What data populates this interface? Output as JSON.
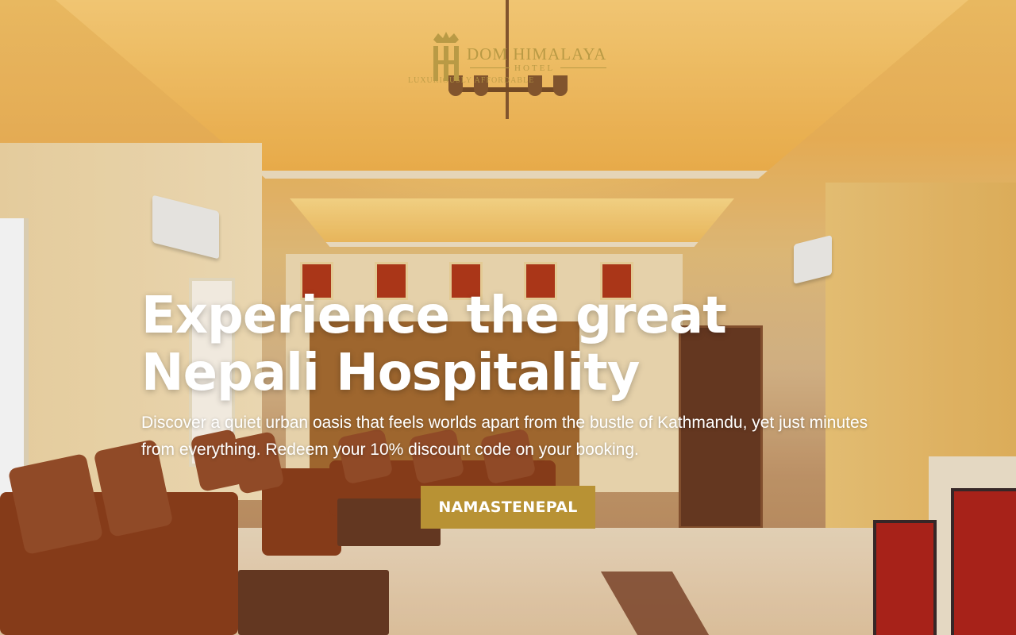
{
  "logo": {
    "name": "DOM HIMALAYA",
    "sub": "HOTEL",
    "tagline": "LUXURIOUSLY AFFORDABLE"
  },
  "hero": {
    "headline": "Experience the great Nepali Hospitality",
    "subtext": "Discover a quiet urban oasis that feels worlds apart from the bustle of Kathmandu, yet just minutes from everything. Redeem your 10% discount code on your booking.",
    "cta_label": "NAMASTENEPAL"
  },
  "colors": {
    "accent": "#b89234",
    "text": "#ffffff"
  }
}
